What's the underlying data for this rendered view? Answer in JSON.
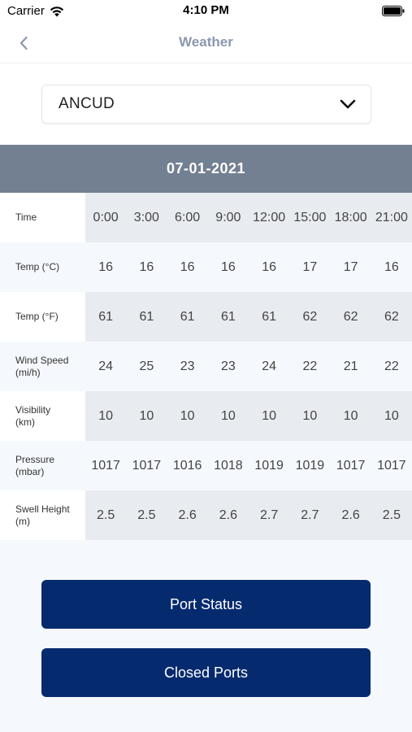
{
  "status_bar": {
    "carrier": "Carrier",
    "time": "4:10 PM"
  },
  "nav": {
    "title": "Weather",
    "back_icon": "chevron-left-icon"
  },
  "location_select": {
    "selected": "ANCUD",
    "icon": "chevron-down-icon"
  },
  "forecast": {
    "date": "07-01-2021",
    "rows": [
      {
        "label": "Time",
        "values": [
          "0:00",
          "3:00",
          "6:00",
          "9:00",
          "12:00",
          "15:00",
          "18:00",
          "21:00"
        ]
      },
      {
        "label": "Temp (°C)",
        "values": [
          "16",
          "16",
          "16",
          "16",
          "16",
          "17",
          "17",
          "16"
        ]
      },
      {
        "label": "Temp (°F)",
        "values": [
          "61",
          "61",
          "61",
          "61",
          "61",
          "62",
          "62",
          "62"
        ]
      },
      {
        "label": "Wind Speed (mi/h)",
        "values": [
          "24",
          "25",
          "23",
          "23",
          "24",
          "22",
          "21",
          "22"
        ]
      },
      {
        "label": "Visibility (km)",
        "values": [
          "10",
          "10",
          "10",
          "10",
          "10",
          "10",
          "10",
          "10"
        ]
      },
      {
        "label": "Pressure (mbar)",
        "values": [
          "1017",
          "1017",
          "1016",
          "1018",
          "1019",
          "1019",
          "1017",
          "1017"
        ]
      },
      {
        "label": "Swell Height (m)",
        "values": [
          "2.5",
          "2.5",
          "2.6",
          "2.6",
          "2.7",
          "2.7",
          "2.6",
          "2.5"
        ]
      }
    ]
  },
  "actions": {
    "port_status": "Port Status",
    "closed_ports": "Closed Ports"
  },
  "colors": {
    "header_bg": "#738092",
    "button_bg": "#062a6e",
    "nav_title": "#8a98ad"
  }
}
